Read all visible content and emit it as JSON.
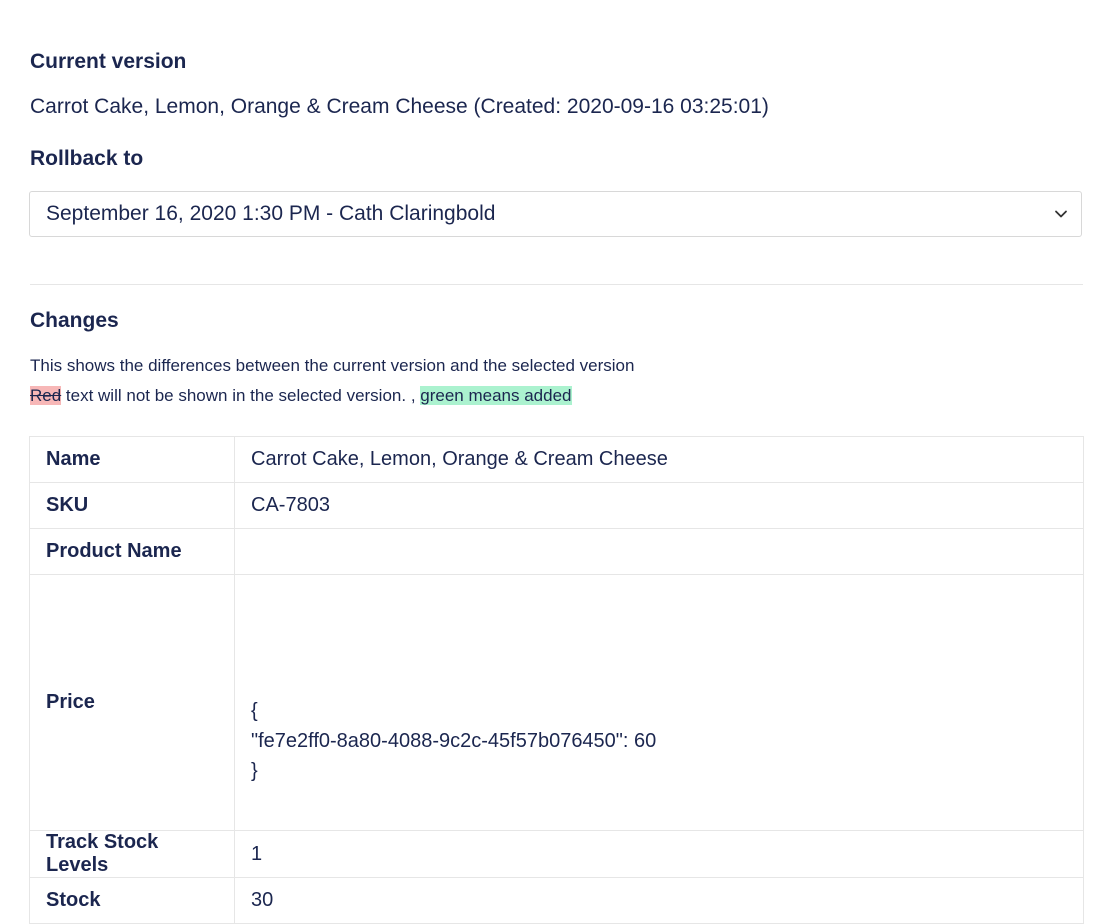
{
  "current_version": {
    "heading": "Current version",
    "text": "Carrot Cake, Lemon, Orange & Cream Cheese (Created: 2020-09-16 03:25:01)"
  },
  "rollback": {
    "heading": "Rollback to",
    "selected": "September 16, 2020 1:30 PM - Cath Claringbold"
  },
  "changes": {
    "heading": "Changes",
    "description": "This shows the differences between the current version and the selected version",
    "legend": {
      "removed_word": "Red",
      "middle_text": " text will not be shown in the selected version. , ",
      "added_text": "green means added"
    },
    "rows": [
      {
        "key": "Name",
        "value": "Carrot Cake, Lemon, Orange & Cream Cheese"
      },
      {
        "key": "SKU",
        "value": "CA-7803"
      },
      {
        "key": "Product Name",
        "value": ""
      },
      {
        "key": "Price",
        "value_lines": [
          "{",
          "\"fe7e2ff0-8a80-4088-9c2c-45f57b076450\": 60",
          "}"
        ]
      },
      {
        "key": "Track Stock Levels",
        "value": "1"
      },
      {
        "key": "Stock",
        "value": "30"
      }
    ]
  },
  "colors": {
    "text": "#1b264f",
    "removed_bg": "#f7b7b7",
    "added_bg": "#abf2cf",
    "border": "#e6e6e6"
  },
  "icons": {
    "select_chevron": "chevron-down-icon"
  }
}
